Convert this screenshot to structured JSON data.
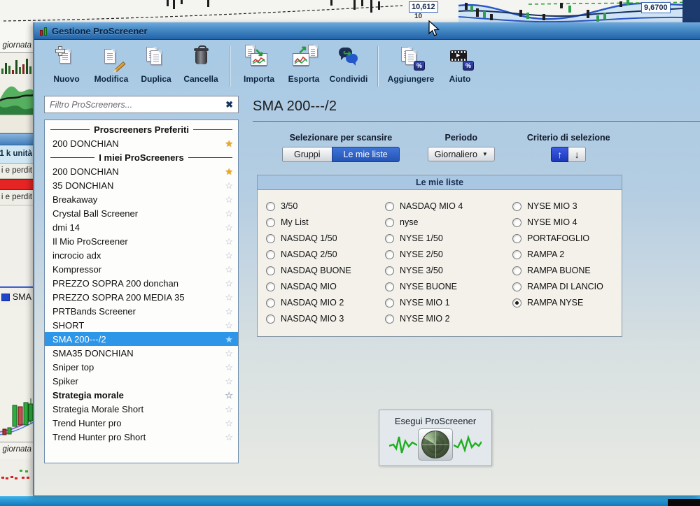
{
  "window": {
    "title": "Gestione ProScreener"
  },
  "toolbar": {
    "buttons": [
      {
        "label": "Nuovo",
        "icon": "new-document-icon"
      },
      {
        "label": "Modifica",
        "icon": "edit-document-icon"
      },
      {
        "label": "Duplica",
        "icon": "duplicate-document-icon"
      },
      {
        "label": "Cancella",
        "icon": "trash-icon"
      },
      {
        "label": "Importa",
        "icon": "import-icon"
      },
      {
        "label": "Esporta",
        "icon": "export-icon"
      },
      {
        "label": "Condividi",
        "icon": "share-bubbles-icon"
      },
      {
        "label": "Aggiungere",
        "icon": "add-documents-percent-icon"
      },
      {
        "label": "Aiuto",
        "icon": "help-video-percent-icon"
      }
    ]
  },
  "sidebar": {
    "filter_placeholder": "Filtro ProScreeners...",
    "items": [
      {
        "type": "header",
        "label": "Proscreeners Preferiti"
      },
      {
        "type": "item",
        "label": "200 DONCHIAN",
        "star": "gold"
      },
      {
        "type": "header",
        "label": "I miei ProScreeners"
      },
      {
        "type": "item",
        "label": "200 DONCHIAN",
        "star": "gold"
      },
      {
        "type": "item",
        "label": "35 DONCHIAN",
        "star": "empty"
      },
      {
        "type": "item",
        "label": "Breakaway",
        "star": "empty"
      },
      {
        "type": "item",
        "label": "Crystal Ball Screener",
        "star": "empty"
      },
      {
        "type": "item",
        "label": "dmi 14",
        "star": "empty"
      },
      {
        "type": "item",
        "label": "Il Mio ProScreener",
        "star": "empty"
      },
      {
        "type": "item",
        "label": "incrocio adx",
        "star": "empty"
      },
      {
        "type": "item",
        "label": "Kompressor",
        "star": "empty"
      },
      {
        "type": "item",
        "label": "PREZZO SOPRA 200 donchan",
        "star": "empty"
      },
      {
        "type": "item",
        "label": "PREZZO SOPRA 200 MEDIA 35",
        "star": "empty"
      },
      {
        "type": "item",
        "label": "PRTBands Screener",
        "star": "empty"
      },
      {
        "type": "item",
        "label": "SHORT",
        "star": "empty"
      },
      {
        "type": "item",
        "label": "SMA 200---/2",
        "star": "blue",
        "selected": true
      },
      {
        "type": "item",
        "label": "SMA35 DONCHIAN",
        "star": "empty"
      },
      {
        "type": "item",
        "label": "Sniper top",
        "star": "empty"
      },
      {
        "type": "item",
        "label": "Spiker",
        "star": "empty"
      },
      {
        "type": "item",
        "label": "Strategia morale",
        "star": "empty",
        "bold": true
      },
      {
        "type": "item",
        "label": "Strategia Morale Short",
        "star": "empty"
      },
      {
        "type": "item",
        "label": "Trend Hunter pro",
        "star": "empty"
      },
      {
        "type": "item",
        "label": "Trend Hunter pro Short",
        "star": "empty"
      }
    ]
  },
  "main": {
    "title": "SMA 200---/2",
    "scan": {
      "label": "Selezionare per scansire",
      "tabs": [
        {
          "label": "Gruppi",
          "active": false
        },
        {
          "label": "Le mie liste",
          "active": true
        }
      ]
    },
    "period": {
      "label": "Periodo",
      "value": "Giornaliero"
    },
    "criteria": {
      "label": "Criterio di selezione",
      "active_sort": "ascending"
    },
    "list_panel": {
      "title": "Le mie liste",
      "columns": [
        [
          "3/50",
          "My List",
          "NASDAQ 1/50",
          "NASDAQ 2/50",
          "NASDAQ BUONE",
          "NASDAQ MIO",
          "NASDAQ MIO 2",
          "NASDAQ MIO 3"
        ],
        [
          "NASDAQ MIO 4",
          "nyse",
          "NYSE 1/50",
          "NYSE 2/50",
          "NYSE 3/50",
          "NYSE BUONE",
          "NYSE MIO 1",
          "NYSE MIO 2"
        ],
        [
          "NYSE MIO 3",
          "NYSE MIO 4",
          "PORTAFOGLIO",
          "RAMPA 2",
          "RAMPA BUONE",
          "RAMPA DI LANCIO",
          "RAMPA NYSE"
        ]
      ],
      "selected_option": "RAMPA NYSE"
    },
    "run_button": {
      "label": "Esegui ProScreener",
      "icon": "radar-icon"
    }
  },
  "background": {
    "left_price_label": "10,612",
    "left_axis_tick": "10",
    "right_price_label": "9,6700",
    "fragments": {
      "top_left": "giornata",
      "units": "1 k unità",
      "pnl_upper": "i e perdit",
      "pnl_lower": "i e perdit",
      "legend_sma": "SMA",
      "bottom_left": "giornata"
    }
  },
  "colors": {
    "titlebar_top": "#6fa9dc",
    "titlebar_bottom": "#2263a8",
    "dialog_bg_top": "#a6c9e5",
    "dialog_bg_bottom": "#e9eae4",
    "selected_row": "#2e96e8",
    "active_tab": "#2454b4",
    "criteria_active": "#1c38b8",
    "panel_header": "#a9c7e3",
    "panel_body": "#f3f1ea",
    "favorite_star": "#f0a71a",
    "ecg_green": "#1fae1f",
    "taskbar_blue": "#2aa0dc"
  }
}
